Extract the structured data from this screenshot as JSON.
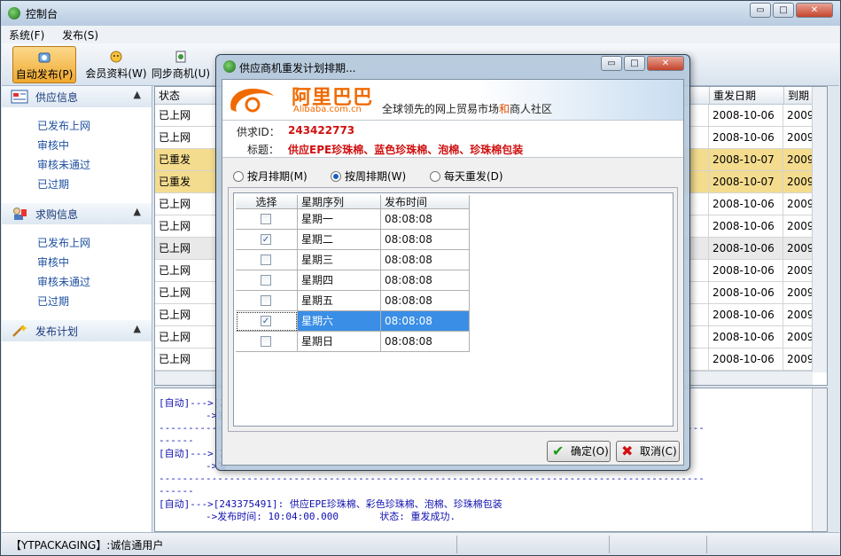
{
  "window": {
    "title": "控制台",
    "min": "▭",
    "max": "□",
    "close": "✕"
  },
  "menu": [
    "系统(F)",
    "发布(S)"
  ],
  "toolbar": [
    {
      "label": "自动发布(P)",
      "icon": "auto-publish-icon"
    },
    {
      "label": "会员资料(W)",
      "icon": "member-icon"
    },
    {
      "label": "同步商机(U)",
      "icon": "sync-icon"
    }
  ],
  "sidebar": {
    "sections": [
      {
        "title": "供应信息",
        "icon": "supply-icon",
        "items": [
          "已发布上网",
          "审核中",
          "审核未通过",
          "已过期"
        ]
      },
      {
        "title": "求购信息",
        "icon": "purchase-icon",
        "items": [
          "已发布上网",
          "审核中",
          "审核未通过",
          "已过期"
        ]
      },
      {
        "title": "发布计划",
        "icon": "plan-icon",
        "items": []
      }
    ],
    "chevron": "▲"
  },
  "grid": {
    "headers": {
      "status": "状态",
      "redate": "重发日期",
      "expire": "到期时"
    },
    "rows": [
      {
        "status": "已上网",
        "redate": "2008-10-06",
        "expire": "2009",
        "style": ""
      },
      {
        "status": "已上网",
        "redate": "2008-10-06",
        "expire": "2009",
        "style": ""
      },
      {
        "status": "已重发",
        "redate": "2008-10-07",
        "expire": "2009",
        "style": "y"
      },
      {
        "status": "已重发",
        "redate": "2008-10-07",
        "expire": "2009",
        "style": "y"
      },
      {
        "status": "已上网",
        "redate": "2008-10-06",
        "expire": "2009",
        "style": ""
      },
      {
        "status": "已上网",
        "redate": "2008-10-06",
        "expire": "2009",
        "style": ""
      },
      {
        "status": "已上网",
        "redate": "2008-10-06",
        "expire": "2009",
        "style": "g"
      },
      {
        "status": "已上网",
        "redate": "2008-10-06",
        "expire": "2009",
        "style": ""
      },
      {
        "status": "已上网",
        "redate": "2008-10-06",
        "expire": "2009",
        "style": ""
      },
      {
        "status": "已上网",
        "redate": "2008-10-06",
        "expire": "2009",
        "style": ""
      },
      {
        "status": "已上网",
        "redate": "2008-10-06",
        "expire": "2009",
        "style": ""
      },
      {
        "status": "已上网",
        "redate": "2008-10-06",
        "expire": "2009",
        "style": ""
      }
    ]
  },
  "log": {
    "lines": [
      "[自动]--->[2",
      "        ->发",
      "---------------------------------------------------------------------------------------------",
      "------",
      "[自动]--->[2",
      "        ->发",
      "---------------------------------------------------------------------------------------------",
      "------",
      "[自动]--->[243375491]: 供应EPE珍珠棉、彩色珍珠棉、泡棉、珍珠棉包装",
      "        ->发布时间: 10:04:00.000       状态: 重发成功."
    ]
  },
  "statusbar": {
    "text": "【YTPACKAGING】:诚信通用户"
  },
  "dialog": {
    "title": "供应商机重发计划排期...",
    "logo_cn": "阿里巴巴",
    "logo_en": "Alibaba.com.cn",
    "slogan_a": "全球领先的网上贸易市场",
    "slogan_b": "和",
    "slogan_c": "商人社区",
    "id_label": "供求ID：",
    "id_value": "243422773",
    "subject_label": "标题：",
    "subject_value": "供应EPE珍珠棉、蓝色珍珠棉、泡棉、珍珠棉包装",
    "radios": [
      {
        "label": "按月排期(M)",
        "checked": false
      },
      {
        "label": "按周排期(W)",
        "checked": true
      },
      {
        "label": "每天重发(D)",
        "checked": false
      }
    ],
    "table": {
      "headers": [
        "选择",
        "星期序列",
        "发布时间"
      ],
      "rows": [
        {
          "checked": false,
          "day": "星期一",
          "time": "08:08:08",
          "selected": false
        },
        {
          "checked": true,
          "day": "星期二",
          "time": "08:08:08",
          "selected": false
        },
        {
          "checked": false,
          "day": "星期三",
          "time": "08:08:08",
          "selected": false
        },
        {
          "checked": false,
          "day": "星期四",
          "time": "08:08:08",
          "selected": false
        },
        {
          "checked": false,
          "day": "星期五",
          "time": "08:08:08",
          "selected": false
        },
        {
          "checked": true,
          "day": "星期六",
          "time": "08:08:08",
          "selected": true
        },
        {
          "checked": false,
          "day": "星期日",
          "time": "08:08:08",
          "selected": false
        }
      ]
    },
    "ok_label": "确定(O)",
    "cancel_label": "取消(C)"
  }
}
